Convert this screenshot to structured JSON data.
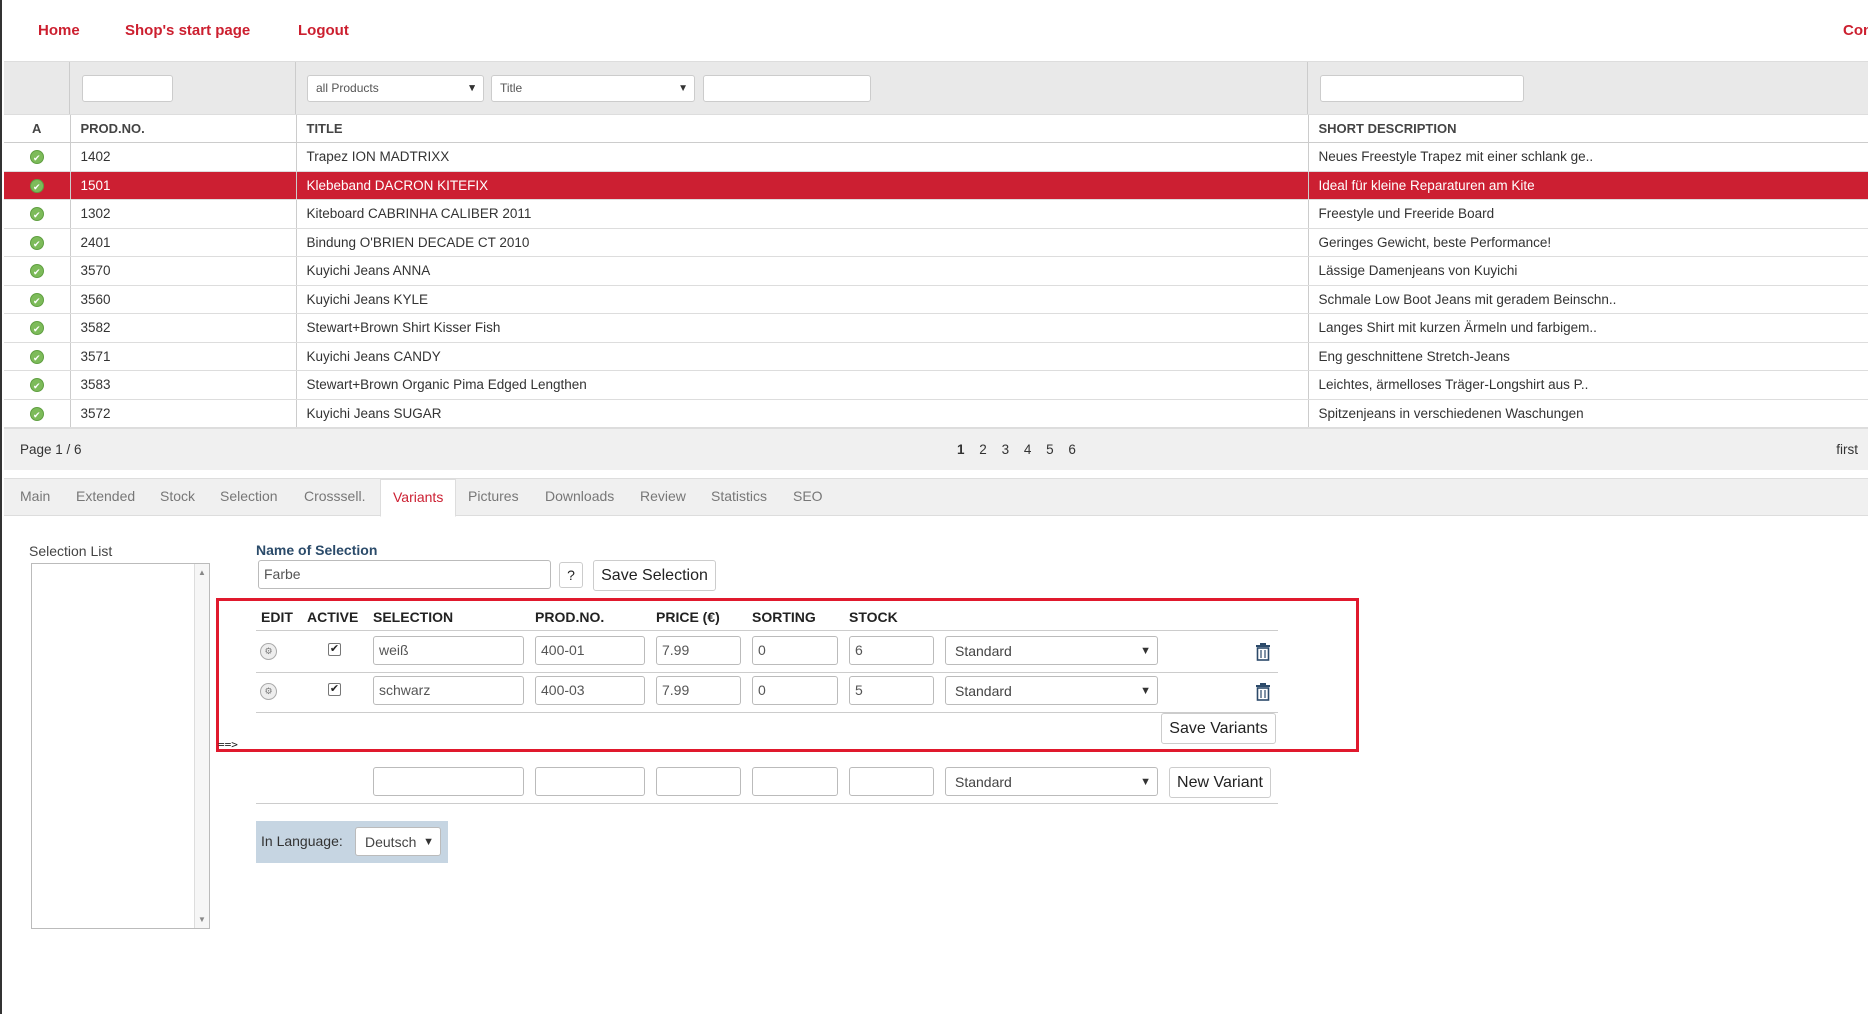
{
  "nav": {
    "home": "Home",
    "shop_start": "Shop's start page",
    "logout": "Logout",
    "right_link": "Con"
  },
  "filters": {
    "category": "all Products",
    "field": "Title"
  },
  "table": {
    "headers": {
      "active": "A",
      "prodno": "PROD.NO.",
      "title": "TITLE",
      "short": "SHORT DESCRIPTION"
    },
    "rows": [
      {
        "prodno": "1402",
        "title": "Trapez ION MADTRIXX",
        "short": "Neues Freestyle Trapez mit einer schlank ge.."
      },
      {
        "prodno": "1501",
        "title": "Klebeband DACRON KITEFIX",
        "short": "Ideal für kleine Reparaturen am Kite"
      },
      {
        "prodno": "1302",
        "title": "Kiteboard CABRINHA CALIBER 2011",
        "short": "Freestyle und Freeride Board"
      },
      {
        "prodno": "2401",
        "title": "Bindung O'BRIEN DECADE CT 2010",
        "short": "Geringes Gewicht, beste Performance!"
      },
      {
        "prodno": "3570",
        "title": "Kuyichi Jeans ANNA",
        "short": "Lässige Damenjeans von Kuyichi"
      },
      {
        "prodno": "3560",
        "title": "Kuyichi Jeans KYLE",
        "short": "Schmale Low Boot Jeans mit geradem Beinschn.."
      },
      {
        "prodno": "3582",
        "title": "Stewart+Brown Shirt Kisser Fish",
        "short": "Langes Shirt mit kurzen Ärmeln und farbigem.."
      },
      {
        "prodno": "3571",
        "title": "Kuyichi Jeans CANDY",
        "short": "Eng geschnittene Stretch-Jeans"
      },
      {
        "prodno": "3583",
        "title": "Stewart+Brown Organic Pima Edged Lengthen",
        "short": "Leichtes, ärmelloses Träger-Longshirt aus P.."
      },
      {
        "prodno": "3572",
        "title": "Kuyichi Jeans SUGAR",
        "short": "Spitzenjeans in verschiedenen Waschungen"
      }
    ],
    "selected_row": "1501"
  },
  "pager": {
    "info": "Page 1 / 6",
    "pages": [
      "1",
      "2",
      "3",
      "4",
      "5",
      "6"
    ],
    "current": "1",
    "first": "first"
  },
  "tabs": [
    "Main",
    "Extended",
    "Stock",
    "Selection",
    "Crosssell.",
    "Variants",
    "Pictures",
    "Downloads",
    "Review",
    "Statistics",
    "SEO"
  ],
  "active_tab": "Variants",
  "variants": {
    "selection_list_label": "Selection List",
    "name_label": "Name of Selection",
    "name_value": "Farbe",
    "help": "?",
    "save_selection": "Save Selection",
    "headers": {
      "edit": "EDIT",
      "active": "ACTIVE",
      "selection": "SELECTION",
      "prodno": "PROD.NO.",
      "price": "PRICE (€)",
      "sorting": "SORTING",
      "stock": "STOCK"
    },
    "rows": [
      {
        "selection": "weiß",
        "prodno": "400-01",
        "price": "7.99",
        "sorting": "0",
        "stock": "6",
        "type": "Standard",
        "active": true
      },
      {
        "selection": "schwarz",
        "prodno": "400-03",
        "price": "7.99",
        "sorting": "0",
        "stock": "5",
        "type": "Standard",
        "active": true
      }
    ],
    "save_variants": "Save Variants",
    "arrow_mark": "==>",
    "new_type": "Standard",
    "new_variant": "New Variant",
    "language_label": "In Language:",
    "language_value": "Deutsch"
  },
  "colors": {
    "accent": "#cc1f32",
    "highlight_box": "#e0192d",
    "ok_icon": "#7dbb5a"
  }
}
